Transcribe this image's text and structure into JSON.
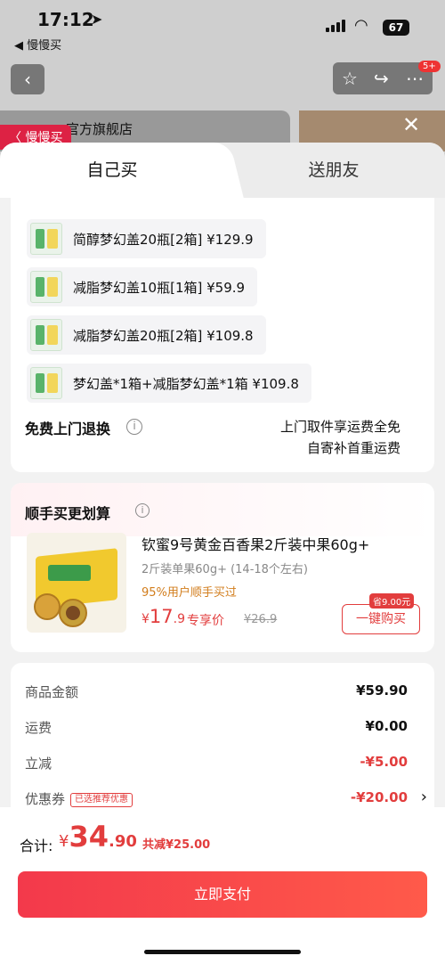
{
  "status": {
    "time": "17:12",
    "back_app": "◀ 慢慢买",
    "battery": "67"
  },
  "background": {
    "store_name": "官方旗舰店",
    "tag": "〈 慢慢买",
    "badge": "5+"
  },
  "tabs": [
    {
      "label": "自己买"
    },
    {
      "label": "送朋友"
    }
  ],
  "options": [
    {
      "label": "简醇梦幻盖20瓶[2箱]  ¥129.9"
    },
    {
      "label": "减脂梦幻盖10瓶[1箱]  ¥59.9"
    },
    {
      "label": "减脂梦幻盖20瓶[2箱]  ¥109.8"
    },
    {
      "label": "梦幻盖*1箱+减脂梦幻盖*1箱  ¥109.8"
    }
  ],
  "return": {
    "title": "免费上门退换",
    "line1": "上门取件享运费全免",
    "line2": "自寄补首重运费"
  },
  "addon": {
    "title": "顺手买更划算",
    "name": "钦蜜9号黄金百香果2斤装中果60g+",
    "spec": "2斤装单果60g+ (14-18个左右)",
    "percent": "95%用户顺手买过",
    "price_cur": "¥",
    "price_int": "17",
    "price_dec": ".9",
    "exclusive": "专享价",
    "old_price": "¥26.9",
    "save_badge": "省9.00元",
    "buy_label": "一键购买"
  },
  "summary": [
    {
      "label": "商品金额",
      "value": "¥59.90"
    },
    {
      "label": "运费",
      "value": "¥0.00"
    },
    {
      "label": "立减",
      "value": "-¥5.00"
    },
    {
      "label": "优惠券",
      "tag": "已选推荐优惠",
      "value": "-¥20.00"
    }
  ],
  "footer": {
    "total_label": "合计:",
    "total_cur": "¥",
    "total_int": "34",
    "total_dec": ".90",
    "total_save": "共减¥25.00",
    "pay_label": "立即支付"
  },
  "colors": {
    "accent": "#e23d3d",
    "pay_gradient_start": "#f3394b",
    "pay_gradient_end": "#ff5a4a"
  }
}
